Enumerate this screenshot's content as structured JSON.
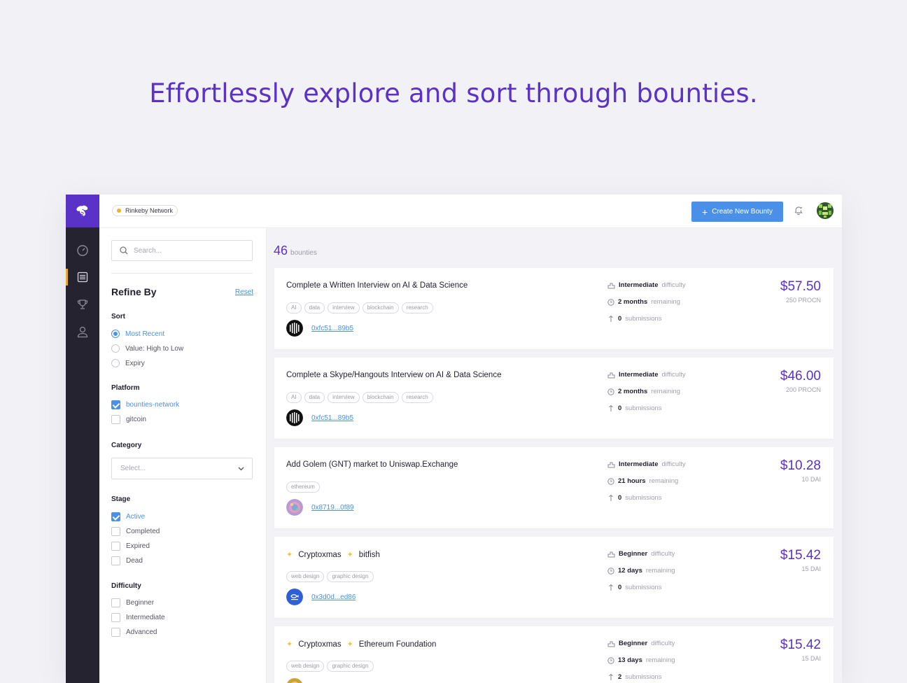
{
  "headline": "Effortlessly explore and sort through bounties.",
  "topbar": {
    "network": "Rinkeby Network",
    "create_button": "Create New Bounty"
  },
  "filters": {
    "search_placeholder": "Search...",
    "title": "Refine By",
    "reset": "Reset",
    "sort": {
      "title": "Sort",
      "options": [
        {
          "label": "Most Recent",
          "selected": true
        },
        {
          "label": "Value: High to Low",
          "selected": false
        },
        {
          "label": "Expiry",
          "selected": false
        }
      ]
    },
    "platform": {
      "title": "Platform",
      "options": [
        {
          "label": "bounties-network",
          "checked": true
        },
        {
          "label": "gitcoin",
          "checked": false
        }
      ]
    },
    "category": {
      "title": "Category",
      "placeholder": "Select..."
    },
    "stage": {
      "title": "Stage",
      "options": [
        {
          "label": "Active",
          "checked": true
        },
        {
          "label": "Completed",
          "checked": false
        },
        {
          "label": "Expired",
          "checked": false
        },
        {
          "label": "Dead",
          "checked": false
        }
      ]
    },
    "difficulty": {
      "title": "Difficulty",
      "options": [
        {
          "label": "Beginner",
          "checked": false
        },
        {
          "label": "Intermediate",
          "checked": false
        },
        {
          "label": "Advanced",
          "checked": false
        }
      ]
    }
  },
  "results": {
    "count": "46",
    "count_label": "bounties"
  },
  "labels": {
    "difficulty": "difficulty",
    "remaining": "remaining",
    "submissions": "submissions"
  },
  "bounties": [
    {
      "title": "Complete a Written Interview on AI & Data Science",
      "tags": [
        "AI",
        "data",
        "interview",
        "blockchain",
        "research"
      ],
      "address": "0xfc51...89b5",
      "difficulty": "Intermediate",
      "time": "2 months",
      "submissions": "0",
      "usd": "$57.50",
      "token": "250 PROCN"
    },
    {
      "title": "Complete a Skype/Hangouts Interview on AI & Data Science",
      "tags": [
        "AI",
        "data",
        "interview",
        "blockchain",
        "research"
      ],
      "address": "0xfc51...89b5",
      "difficulty": "Intermediate",
      "time": "2 months",
      "submissions": "0",
      "usd": "$46.00",
      "token": "200 PROCN"
    },
    {
      "title": "Add Golem (GNT) market to Uniswap.Exchange",
      "tags": [
        "ethereum"
      ],
      "address": "0x8719...0f89",
      "difficulty": "Intermediate",
      "time": "21 hours",
      "submissions": "0",
      "usd": "$10.28",
      "token": "10 DAI"
    },
    {
      "title_a": "Cryptoxmas",
      "title_b": "bitfish",
      "tags": [
        "web design",
        "graphic design"
      ],
      "address": "0x3d0d...ed86",
      "difficulty": "Beginner",
      "time": "12 days",
      "submissions": "0",
      "usd": "$15.42",
      "token": "15 DAI"
    },
    {
      "title_a": "Cryptoxmas",
      "title_b": "Ethereum Foundation",
      "tags": [
        "web design",
        "graphic design"
      ],
      "address": "",
      "difficulty": "Beginner",
      "time": "13 days",
      "submissions": "2",
      "usd": "$15.42",
      "token": "15 DAI"
    }
  ],
  "colors": {
    "brand": "#5a32c8",
    "accent": "#4a90e8",
    "rail": "#25232f",
    "rail_active": "#e8a73a"
  }
}
